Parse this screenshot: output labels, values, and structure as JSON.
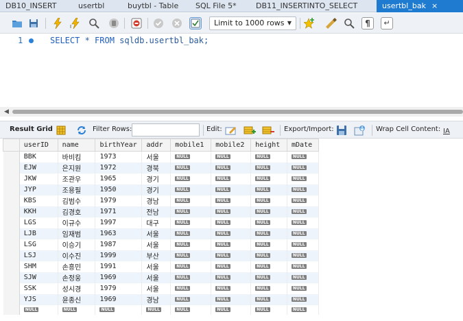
{
  "tabs": [
    {
      "label": "DB10_INSERT",
      "active": false
    },
    {
      "label": "usertbl",
      "active": false
    },
    {
      "label": "buytbl - Table",
      "active": false
    },
    {
      "label": "SQL File 5*",
      "active": false
    },
    {
      "label": "DB11_INSERTINTO_SELECT",
      "active": false
    },
    {
      "label": "usertbl_bak",
      "active": true
    }
  ],
  "tab_close": "×",
  "toolbar": {
    "limit_label": "Limit to 1000 rows",
    "icons": [
      "open-folder-icon",
      "save-icon",
      "execute-icon",
      "execute-current-icon",
      "explain-icon",
      "stop-icon",
      "toggle-error-icon",
      "commit-icon",
      "rollback-icon",
      "autocommit-icon",
      "bookmark-icon",
      "beautify-icon",
      "find-icon",
      "invisible-chars-icon",
      "wrap-icon"
    ]
  },
  "editor": {
    "line_number": "1",
    "code_keyword1": "SELECT",
    "code_rest1": " * ",
    "code_keyword2": "FROM",
    "code_rest2": " sqldb.usertbl_bak;"
  },
  "result_toolbar": {
    "result_grid": "Result Grid",
    "filter_rows": "Filter Rows:",
    "edit": "Edit:",
    "export_import": "Export/Import:",
    "wrap_cell": "Wrap Cell Content:"
  },
  "grid": {
    "columns": [
      "userID",
      "name",
      "birthYear",
      "addr",
      "mobile1",
      "mobile2",
      "height",
      "mDate"
    ],
    "null_label": "NULL",
    "rows": [
      [
        "BBK",
        "바비킴",
        "1973",
        "서울"
      ],
      [
        "EJW",
        "은지원",
        "1972",
        "경북"
      ],
      [
        "JKW",
        "조관우",
        "1965",
        "경기"
      ],
      [
        "JYP",
        "조용필",
        "1950",
        "경기"
      ],
      [
        "KBS",
        "김범수",
        "1979",
        "경남"
      ],
      [
        "KKH",
        "김경호",
        "1971",
        "전남"
      ],
      [
        "LGS",
        "이규수",
        "1997",
        "대구"
      ],
      [
        "LJB",
        "임재범",
        "1963",
        "서울"
      ],
      [
        "LSG",
        "이승기",
        "1987",
        "서울"
      ],
      [
        "LSJ",
        "이수진",
        "1999",
        "부산"
      ],
      [
        "SHM",
        "손흥민",
        "1991",
        "서울"
      ],
      [
        "SJW",
        "손정웅",
        "1969",
        "서울"
      ],
      [
        "SSK",
        "성시경",
        "1979",
        "서울"
      ],
      [
        "YJS",
        "윤종신",
        "1969",
        "경남"
      ]
    ]
  }
}
